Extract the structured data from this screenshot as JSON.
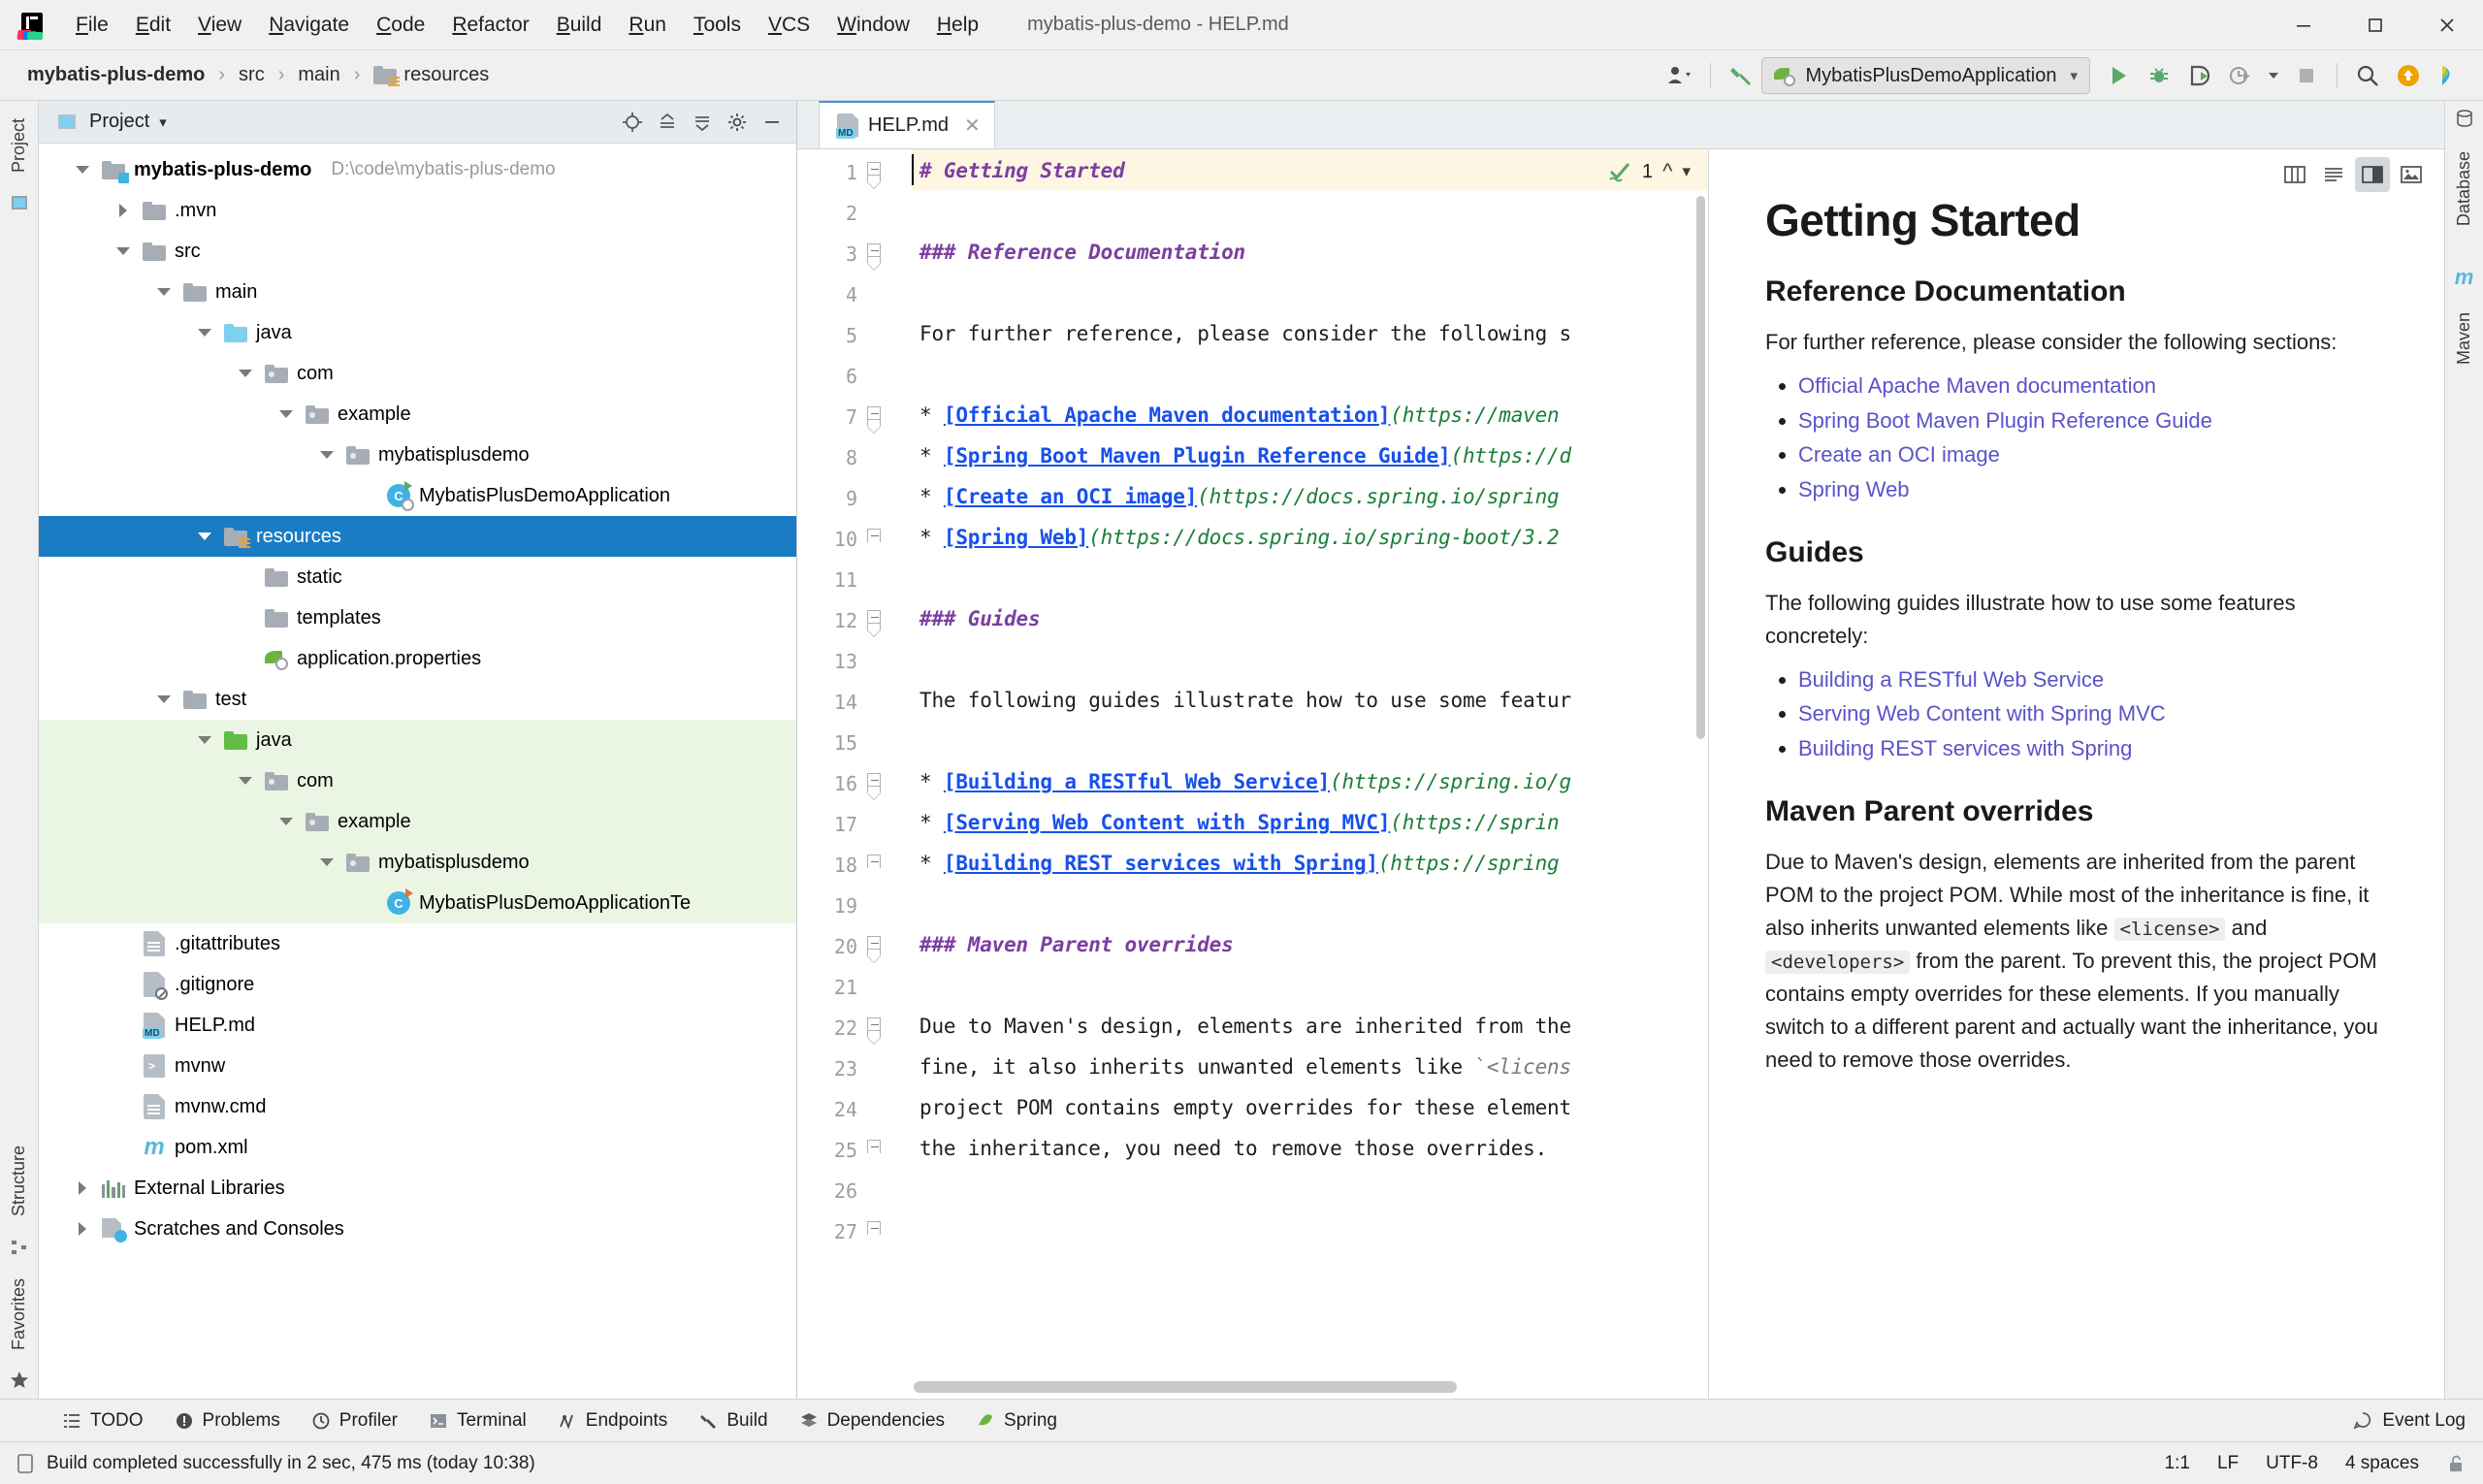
{
  "window": {
    "title": "mybatis-plus-demo - HELP.md",
    "menu": [
      "File",
      "Edit",
      "View",
      "Navigate",
      "Code",
      "Refactor",
      "Build",
      "Run",
      "Tools",
      "VCS",
      "Window",
      "Help"
    ],
    "controls": {
      "minimize": "minimize-button",
      "maximize": "maximize-button",
      "close": "close-button"
    }
  },
  "navbar": {
    "breadcrumbs": [
      "mybatis-plus-demo",
      "src",
      "main",
      "resources"
    ],
    "separator": "›",
    "run_config": "MybatisPlusDemoApplication",
    "icons": [
      "profile-icon",
      "hammer-icon",
      "run-icon",
      "debug-icon",
      "run-coverage-icon",
      "profiler-run-icon",
      "stop-icon",
      "search-icon",
      "update-icon",
      "ai-assistant-icon"
    ]
  },
  "left_rail": {
    "top": [
      "Project"
    ],
    "bottom": [
      "Structure",
      "Favorites"
    ]
  },
  "right_rail": {
    "items": [
      "Database",
      "Maven"
    ]
  },
  "project_panel": {
    "title": "Project",
    "header_icons": [
      "locate-icon",
      "collapse-all-icon",
      "expand-all-icon",
      "settings-icon",
      "hide-icon"
    ],
    "tree": [
      {
        "label": "mybatis-plus-demo",
        "path": "D:\\code\\mybatis-plus-demo",
        "depth": 0,
        "arrow": "down",
        "icon": "project-folder",
        "bold": true
      },
      {
        "label": ".mvn",
        "depth": 1,
        "arrow": "right",
        "icon": "folder-gray"
      },
      {
        "label": "src",
        "depth": 1,
        "arrow": "down",
        "icon": "folder-gray"
      },
      {
        "label": "main",
        "depth": 2,
        "arrow": "down",
        "icon": "folder-gray"
      },
      {
        "label": "java",
        "depth": 3,
        "arrow": "down",
        "icon": "folder-cyan"
      },
      {
        "label": "com",
        "depth": 4,
        "arrow": "down",
        "icon": "folder-package"
      },
      {
        "label": "example",
        "depth": 5,
        "arrow": "down",
        "icon": "folder-package"
      },
      {
        "label": "mybatisplusdemo",
        "depth": 6,
        "arrow": "down",
        "icon": "folder-package"
      },
      {
        "label": "MybatisPlusDemoApplication",
        "depth": 7,
        "arrow": "none",
        "icon": "spring-class-run"
      },
      {
        "label": "resources",
        "depth": 3,
        "arrow": "down",
        "icon": "folder-resources",
        "selected": true
      },
      {
        "label": "static",
        "depth": 4,
        "arrow": "none",
        "icon": "folder-gray"
      },
      {
        "label": "templates",
        "depth": 4,
        "arrow": "none",
        "icon": "folder-gray"
      },
      {
        "label": "application.properties",
        "depth": 4,
        "arrow": "none",
        "icon": "spring-properties"
      },
      {
        "label": "test",
        "depth": 2,
        "arrow": "down",
        "icon": "folder-gray"
      },
      {
        "label": "java",
        "depth": 3,
        "arrow": "down",
        "icon": "folder-green",
        "green": true
      },
      {
        "label": "com",
        "depth": 4,
        "arrow": "down",
        "icon": "folder-package",
        "green": true
      },
      {
        "label": "example",
        "depth": 5,
        "arrow": "down",
        "icon": "folder-package",
        "green": true
      },
      {
        "label": "mybatisplusdemo",
        "depth": 6,
        "arrow": "down",
        "icon": "folder-package",
        "green": true
      },
      {
        "label": "MybatisPlusDemoApplicationTe",
        "depth": 7,
        "arrow": "none",
        "icon": "test-class",
        "green": true
      },
      {
        "label": ".gitattributes",
        "depth": 1,
        "arrow": "none",
        "icon": "text-file"
      },
      {
        "label": ".gitignore",
        "depth": 1,
        "arrow": "none",
        "icon": "ignore-file"
      },
      {
        "label": "HELP.md",
        "depth": 1,
        "arrow": "none",
        "icon": "markdown-file"
      },
      {
        "label": "mvnw",
        "depth": 1,
        "arrow": "none",
        "icon": "shell-file"
      },
      {
        "label": "mvnw.cmd",
        "depth": 1,
        "arrow": "none",
        "icon": "text-file"
      },
      {
        "label": "pom.xml",
        "depth": 1,
        "arrow": "none",
        "icon": "maven-file"
      },
      {
        "label": "External Libraries",
        "depth": 0,
        "arrow": "right",
        "icon": "external-libraries"
      },
      {
        "label": "Scratches and Consoles",
        "depth": 0,
        "arrow": "right",
        "icon": "scratches"
      }
    ]
  },
  "editor": {
    "tab": {
      "label": "HELP.md",
      "icon": "markdown-file"
    },
    "inspection": {
      "count": "1",
      "icon": "inspection-ok-icon"
    },
    "lines": [
      {
        "n": 1,
        "fold": "start",
        "html": "<span class='h'># Getting Started</span>"
      },
      {
        "n": 2,
        "html": ""
      },
      {
        "n": 3,
        "fold": "start",
        "html": "<span class='h'>### Reference Documentation</span>"
      },
      {
        "n": 4,
        "html": ""
      },
      {
        "n": 5,
        "html": "For further reference, please consider the following s"
      },
      {
        "n": 6,
        "html": ""
      },
      {
        "n": 7,
        "fold": "start",
        "html": "* <span class='lk'>[Official Apache Maven documentation]</span><span class='url'>(https://maven</span>"
      },
      {
        "n": 8,
        "html": "* <span class='lk'>[Spring Boot Maven Plugin Reference Guide]</span><span class='url'>(https://d</span>"
      },
      {
        "n": 9,
        "html": "* <span class='lk'>[Create an OCI image]</span><span class='url'>(https://docs.spring.io/spring</span>"
      },
      {
        "n": 10,
        "fold": "end",
        "html": "* <span class='lk'>[Spring Web]</span><span class='url'>(https://docs.spring.io/spring-boot/3.2</span>"
      },
      {
        "n": 11,
        "html": ""
      },
      {
        "n": 12,
        "fold": "start",
        "html": "<span class='h'>### Guides</span>"
      },
      {
        "n": 13,
        "html": ""
      },
      {
        "n": 14,
        "html": "The following guides illustrate how to use some featur"
      },
      {
        "n": 15,
        "html": ""
      },
      {
        "n": 16,
        "fold": "start",
        "html": "* <span class='lk'>[Building a RESTful Web Service]</span><span class='url'>(https://spring.io/g</span>"
      },
      {
        "n": 17,
        "html": "* <span class='lk'>[Serving Web Content with Spring MVC]</span><span class='url'>(https://sprin</span>"
      },
      {
        "n": 18,
        "fold": "end",
        "html": "* <span class='lk'>[Building REST services with Spring]</span><span class='url'>(https://spring</span>"
      },
      {
        "n": 19,
        "html": ""
      },
      {
        "n": 20,
        "fold": "start",
        "html": "<span class='h'>### Maven Parent overrides</span>"
      },
      {
        "n": 21,
        "html": ""
      },
      {
        "n": 22,
        "fold": "start",
        "html": "Due to Maven's design, elements are inherited from the"
      },
      {
        "n": 23,
        "html": "fine, it also inherits unwanted elements like <span class='tick'>`</span><span class='code-s'>&lt;licens</span>"
      },
      {
        "n": 24,
        "html": "project POM contains empty overrides for these element"
      },
      {
        "n": 25,
        "fold": "end",
        "html": "the inheritance, you need to remove those overrides."
      },
      {
        "n": 26,
        "html": ""
      },
      {
        "n": 27,
        "fold": "end-only",
        "html": ""
      }
    ]
  },
  "preview": {
    "toolbar_icons": [
      "split-editor-icon",
      "show-editor-icon",
      "show-editor-and-preview-icon",
      "show-preview-icon"
    ],
    "h1": "Getting Started",
    "sections": [
      {
        "heading": "Reference Documentation",
        "paragraph": "For further reference, please consider the following sections:",
        "links": [
          "Official Apache Maven documentation",
          "Spring Boot Maven Plugin Reference Guide",
          "Create an OCI image",
          "Spring Web"
        ]
      },
      {
        "heading": "Guides",
        "paragraph": "The following guides illustrate how to use some features concretely:",
        "links": [
          "Building a RESTful Web Service",
          "Serving Web Content with Spring MVC",
          "Building REST services with Spring"
        ]
      }
    ],
    "maven_heading": "Maven Parent overrides",
    "maven_paragraph_1": "Due to Maven's design, elements are inherited from the parent POM to the project POM. While most of the inheritance is fine, it also inherits unwanted elements like ",
    "maven_code_1": "<license>",
    "maven_paragraph_2": " and ",
    "maven_code_2": "<developers>",
    "maven_paragraph_3": " from the parent. To prevent this, the project POM contains empty overrides for these elements. If you manually switch to a different parent and actually want the inheritance, you need to remove those overrides."
  },
  "toolwindows": {
    "items": [
      {
        "label": "TODO",
        "icon": "todo-icon"
      },
      {
        "label": "Problems",
        "icon": "problems-icon"
      },
      {
        "label": "Profiler",
        "icon": "profiler-icon"
      },
      {
        "label": "Terminal",
        "icon": "terminal-icon"
      },
      {
        "label": "Endpoints",
        "icon": "endpoints-icon"
      },
      {
        "label": "Build",
        "icon": "build-icon"
      },
      {
        "label": "Dependencies",
        "icon": "dependencies-icon"
      },
      {
        "label": "Spring",
        "icon": "spring-icon"
      }
    ],
    "event_log": {
      "label": "Event Log",
      "icon": "event-log-icon"
    }
  },
  "statusbar": {
    "message": "Build completed successfully in 2 sec, 475 ms (today 10:38)",
    "message_icon": "build-status-icon",
    "caret": "1:1",
    "line_separator": "LF",
    "encoding": "UTF-8",
    "indent": "4 spaces",
    "lock_icon": "unlocked-icon"
  },
  "colors": {
    "selection_blue": "#1a7dc4",
    "test_green_bg": "#eaf6e3",
    "link_blue": "#1750eb",
    "url_green": "#1a7f37",
    "heading_purple": "#7b3fa0",
    "preview_link": "#5b52c9",
    "line_highlight": "#fdf6e3"
  }
}
